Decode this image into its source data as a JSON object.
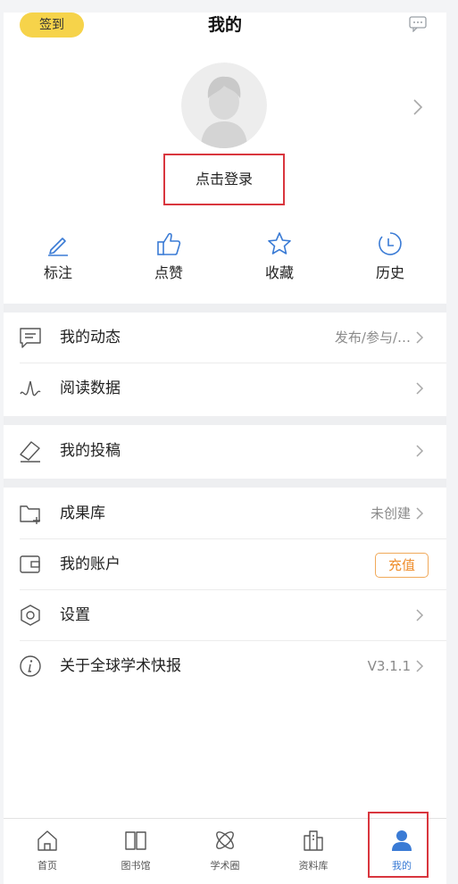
{
  "header": {
    "signin_label": "签到",
    "title": "我的",
    "message_icon": "chat-bubble-icon"
  },
  "profile": {
    "login_label": "点击登录",
    "avatar_icon": "default-avatar-icon"
  },
  "quick_actions": [
    {
      "label": "标注",
      "icon": "pencil-icon"
    },
    {
      "label": "点赞",
      "icon": "thumbs-up-icon"
    },
    {
      "label": "收藏",
      "icon": "star-icon"
    },
    {
      "label": "历史",
      "icon": "clock-icon"
    }
  ],
  "menu": {
    "dynamics": {
      "label": "我的动态",
      "value": "发布/参与/…"
    },
    "reading": {
      "label": "阅读数据"
    },
    "submission": {
      "label": "我的投稿"
    },
    "achievements": {
      "label": "成果库",
      "value": "未创建"
    },
    "account": {
      "label": "我的账户",
      "button": "充值"
    },
    "settings": {
      "label": "设置"
    },
    "about": {
      "label": "关于全球学术快报",
      "value": "V3.1.1"
    }
  },
  "tabs": [
    {
      "label": "首页",
      "icon": "home-icon"
    },
    {
      "label": "图书馆",
      "icon": "book-icon"
    },
    {
      "label": "学术圈",
      "icon": "atom-icon"
    },
    {
      "label": "资料库",
      "icon": "library-icon"
    },
    {
      "label": "我的",
      "icon": "person-icon",
      "active": true
    }
  ],
  "colors": {
    "accent": "#3a7bd5",
    "signin_bg": "#f6d34a",
    "highlight_border": "#d9363e",
    "recharge": "#ef8d2b"
  }
}
